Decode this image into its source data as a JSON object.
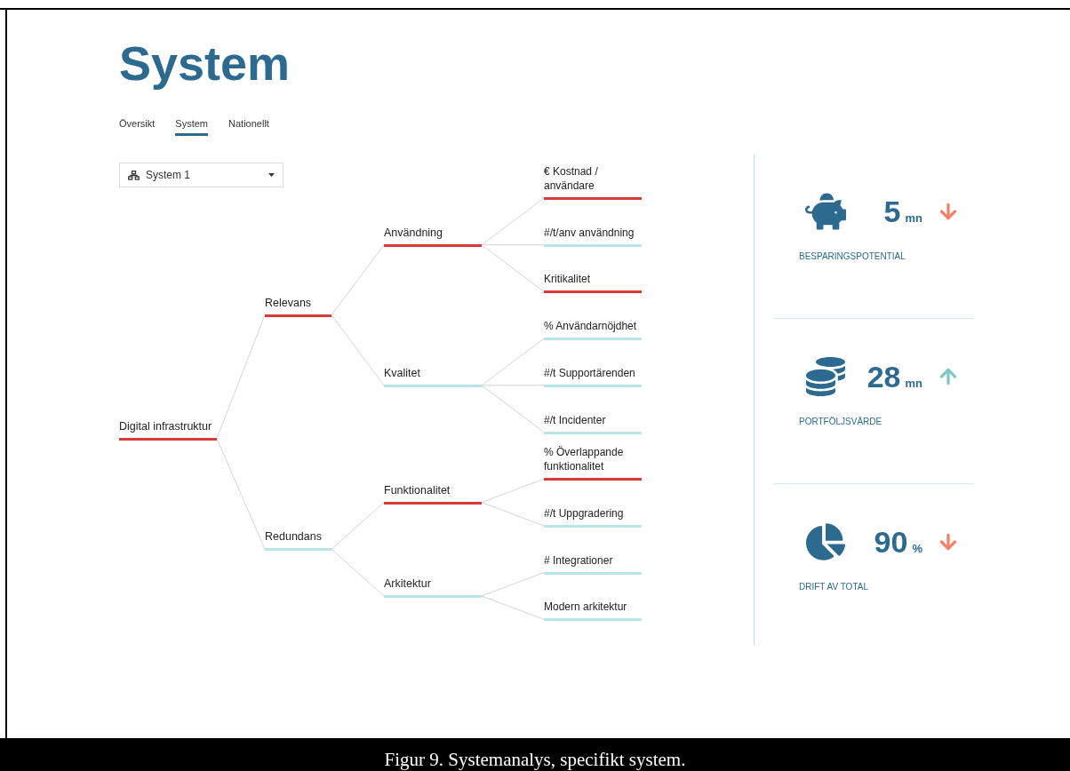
{
  "title": "System",
  "tabs": [
    {
      "label": "Översikt",
      "selected": false
    },
    {
      "label": "System",
      "selected": true
    },
    {
      "label": "Nationellt",
      "selected": false
    }
  ],
  "dropdown": {
    "value": "System 1"
  },
  "tree": {
    "label": "Digital infrastruktur",
    "flagged": true,
    "children": [
      {
        "label": "Relevans",
        "flagged": true,
        "children": [
          {
            "label": "Användning",
            "flagged": true,
            "children": [
              {
                "label": "€ Kostnad / användare",
                "flagged": true
              },
              {
                "label": "#/t/anv användning",
                "flagged": false
              },
              {
                "label": "Kritikalitet",
                "flagged": true
              }
            ]
          },
          {
            "label": "Kvalitet",
            "flagged": false,
            "children": [
              {
                "label": "% Användarnöjdhet",
                "flagged": false
              },
              {
                "label": "#/t Supportärenden",
                "flagged": false
              },
              {
                "label": "#/t Incidenter",
                "flagged": false
              }
            ]
          }
        ]
      },
      {
        "label": "Redundans",
        "flagged": false,
        "children": [
          {
            "label": "Funktionalitet",
            "flagged": true,
            "children": [
              {
                "label": "% Överlappande funktionalitet",
                "flagged": true
              },
              {
                "label": "#/t Uppgradering",
                "flagged": false
              }
            ]
          },
          {
            "label": "Arkitektur",
            "flagged": false,
            "children": [
              {
                "label": "# Integrationer",
                "flagged": false
              },
              {
                "label": "Modern arkitektur",
                "flagged": false
              }
            ]
          }
        ]
      }
    ]
  },
  "stats": [
    {
      "kind": "savings",
      "value": "5",
      "unit": "mn",
      "rising": false,
      "label": "BESPARINGSPOTENTIAL"
    },
    {
      "kind": "portfolio",
      "value": "28",
      "unit": "mn",
      "rising": true,
      "label": "PORTFÖLJSVÄRDE"
    },
    {
      "kind": "share",
      "value": "90",
      "unit": "%",
      "rising": false,
      "label": "DRIFT AV TOTAL"
    }
  ],
  "caption": "Figur 9. Systemanalys, specifikt system."
}
